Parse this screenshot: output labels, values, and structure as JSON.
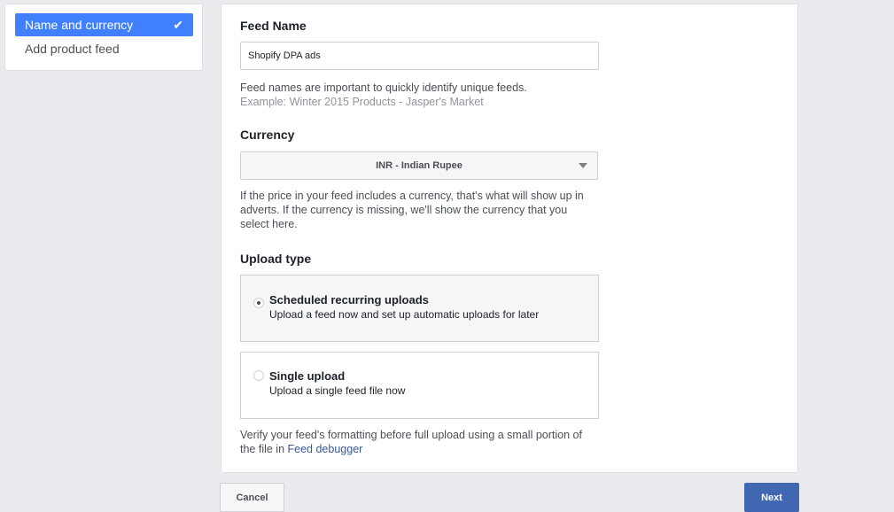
{
  "sidebar": {
    "steps": [
      {
        "label": "Name and currency",
        "completed": true,
        "active": true
      },
      {
        "label": "Add product feed",
        "completed": false,
        "active": false
      }
    ],
    "check_glyph": "✔"
  },
  "form": {
    "feed_name": {
      "label": "Feed Name",
      "value": "Shopify DPA ads",
      "help": "Feed names are important to quickly identify unique feeds.",
      "example": "Example: Winter 2015 Products - Jasper's Market"
    },
    "currency": {
      "label": "Currency",
      "selected": "INR - Indian Rupee",
      "help": "If the price in your feed includes a currency, that's what will show up in adverts. If the currency is missing, we'll show the currency that you select here."
    },
    "upload_type": {
      "label": "Upload type",
      "options": [
        {
          "title": "Scheduled recurring uploads",
          "description": "Upload a feed now and set up automatic uploads for later",
          "selected": true
        },
        {
          "title": "Single upload",
          "description": "Upload a single feed file now",
          "selected": false
        }
      ]
    },
    "verify": {
      "text": "Verify your feed's formatting before full upload using a small portion of the file in ",
      "link": "Feed debugger"
    }
  },
  "footer": {
    "cancel_label": "Cancel",
    "next_label": "Next"
  },
  "colors": {
    "active_step": "#4080ff",
    "primary_button": "#4267b2",
    "link": "#365899",
    "page_background": "#e9ebee"
  }
}
